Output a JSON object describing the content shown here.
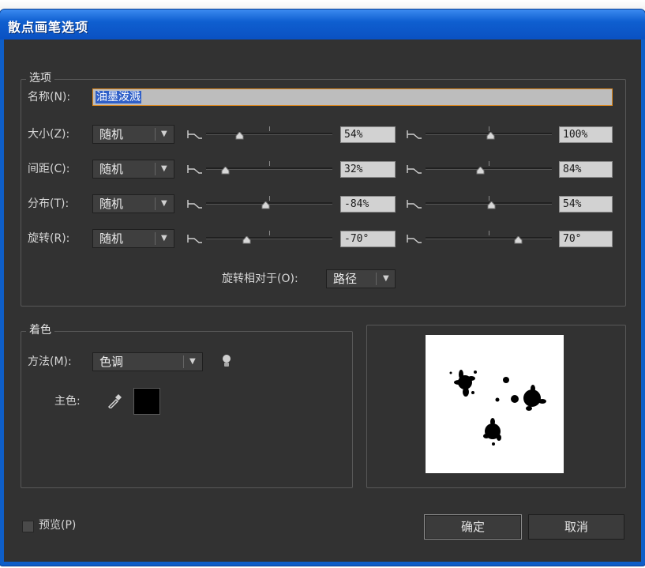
{
  "title": "散点画笔选项",
  "options_group": {
    "label": "选项",
    "name_label": "名称(N):",
    "name_value": "油墨泼溅",
    "rows": [
      {
        "label": "大小(Z):",
        "mode": "随机",
        "min_value": "54%",
        "max_value": "100%",
        "min_pos": 0.26,
        "max_pos": 0.51
      },
      {
        "label": "间距(C):",
        "mode": "随机",
        "min_value": "32%",
        "max_value": "84%",
        "min_pos": 0.15,
        "max_pos": 0.43
      },
      {
        "label": "分布(T):",
        "mode": "随机",
        "min_value": "-84%",
        "max_value": "54%",
        "min_pos": 0.47,
        "max_pos": 0.52
      },
      {
        "label": "旋转(R):",
        "mode": "随机",
        "min_value": "-70°",
        "max_value": "70°",
        "min_pos": 0.32,
        "max_pos": 0.73
      }
    ],
    "rotate_relative_label": "旋转相对于(O):",
    "rotate_relative_value": "路径"
  },
  "coloring_group": {
    "label": "着色",
    "method_label": "方法(M):",
    "method_value": "色调",
    "key_color_label": "主色:",
    "key_color": "#000000"
  },
  "preview_checkbox_label": "预览(P)",
  "ok_label": "确定",
  "cancel_label": "取消",
  "colors": {
    "panel": "#323232",
    "title_bar": "#0f5fd0",
    "focus": "#e08a1e",
    "selection": "#2f5fc8"
  },
  "icons": [
    "slider-lock-icon",
    "dropdown-arrow-icon",
    "lightbulb-tip-icon",
    "eyedropper-icon"
  ]
}
